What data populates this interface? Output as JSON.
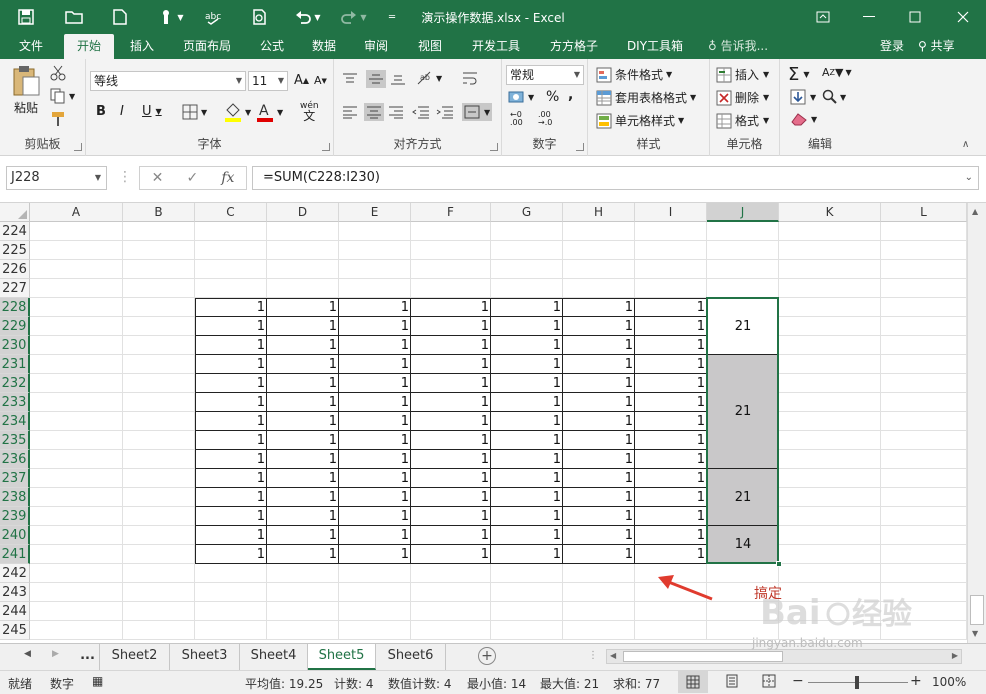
{
  "window": {
    "title": "演示操作数据.xlsx - Excel"
  },
  "menu": {
    "tabs": [
      "文件",
      "开始",
      "插入",
      "页面布局",
      "公式",
      "数据",
      "审阅",
      "视图",
      "开发工具",
      "方方格子",
      "DIY工具箱"
    ],
    "active_tab": "开始",
    "tell_me": "告诉我...",
    "login": "登录",
    "share": "共享"
  },
  "ribbon": {
    "clipboard": {
      "label": "剪贴板",
      "paste": "粘贴"
    },
    "font": {
      "label": "字体",
      "font_name": "等线",
      "font_size": "11",
      "bold": "B",
      "italic": "I",
      "underline": "U",
      "grow": "A",
      "shrink": "A",
      "wen": "wén"
    },
    "alignment": {
      "label": "对齐方式"
    },
    "number": {
      "label": "数字",
      "format": "常规"
    },
    "styles": {
      "label": "样式",
      "conditional": "条件格式",
      "table": "套用表格格式",
      "cell_styles": "单元格样式"
    },
    "cells": {
      "label": "单元格",
      "insert": "插入",
      "delete": "删除",
      "format": "格式"
    },
    "editing": {
      "label": "编辑"
    }
  },
  "formula_bar": {
    "name_box": "J228",
    "formula": "=SUM(C228:I230)",
    "fx": "fx"
  },
  "grid": {
    "columns": [
      "A",
      "B",
      "C",
      "D",
      "E",
      "F",
      "G",
      "H",
      "I",
      "J",
      "K",
      "L"
    ],
    "selected_column": "J",
    "rows": [
      "224",
      "225",
      "226",
      "227",
      "228",
      "229",
      "230",
      "231",
      "232",
      "233",
      "234",
      "235",
      "236",
      "237",
      "238",
      "239",
      "240",
      "241",
      "242",
      "243",
      "244",
      "245"
    ],
    "data_first_row": "228",
    "data_last_row": "241",
    "cell_value": "1",
    "merged_sums": [
      "21",
      "21",
      "21",
      "14"
    ],
    "annotation": "搞定"
  },
  "sheets": {
    "ellipsis": "...",
    "tabs": [
      "Sheet2",
      "Sheet3",
      "Sheet4",
      "Sheet5",
      "Sheet6"
    ],
    "active": "Sheet5"
  },
  "status": {
    "ready": "就绪",
    "mode": "数字",
    "average": "平均值: 19.25",
    "count": "计数: 4",
    "numeric_count": "数值计数: 4",
    "min": "最小值: 14",
    "max": "最大值: 21",
    "sum": "求和: 77",
    "zoom": "100%"
  },
  "watermark": {
    "text": "jingyan.baidu.com"
  },
  "colors": {
    "excel_green": "#217346",
    "annotation_red": "#c0392b",
    "merged_fill": "#c9c8c9"
  }
}
